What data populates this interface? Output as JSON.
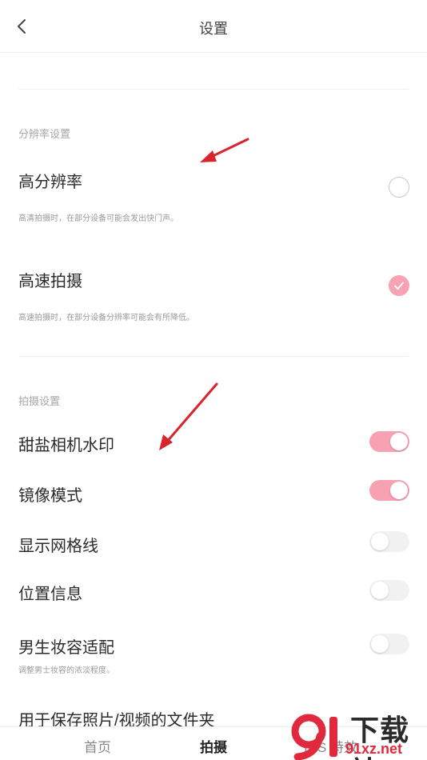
{
  "header": {
    "title": "设置"
  },
  "resolution_section": {
    "label": "分辨率设置",
    "items": [
      {
        "title": "高分辨率",
        "description": "高清拍摄时，在部分设备可能会发出快门声。",
        "selected": false
      },
      {
        "title": "高速拍摄",
        "description": "高速拍摄时，在部分设备分辨率可能会有所降低。",
        "selected": true
      }
    ]
  },
  "shooting_section": {
    "label": "拍摄设置",
    "items": [
      {
        "title": "甜盐相机水印",
        "enabled": true
      },
      {
        "title": "镜像模式",
        "enabled": true
      },
      {
        "title": "显示网格线",
        "enabled": false
      },
      {
        "title": "位置信息",
        "enabled": false
      },
      {
        "title": "男生妆容适配",
        "description": "调整男士妆容的浓淡程度。",
        "enabled": false
      },
      {
        "title": "用于保存照片/视频的文件夹"
      }
    ]
  },
  "bottom_nav": {
    "items": [
      {
        "label": "首页",
        "active": false
      },
      {
        "label": "拍摄",
        "active": true
      },
      {
        "label": "INS 特效",
        "active": false
      }
    ]
  },
  "watermark": {
    "brand": "下载站",
    "domain": "91xz.net"
  },
  "colors": {
    "accent_pink": "#f8a1b3",
    "annotation_arrow": "#d9232d"
  }
}
